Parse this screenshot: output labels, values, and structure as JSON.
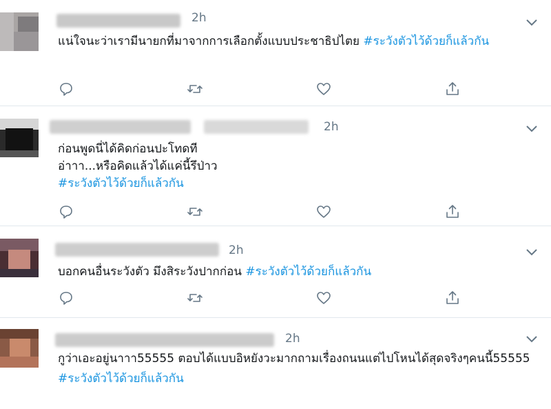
{
  "tweets": [
    {
      "time": "2h",
      "text": "แน่ใจนะว่าเรามีนายกที่มาจากการเลือกตั้งแบบประชาธิปไตย",
      "hashtag": "#ระวังตัวไว้ด้วยก็แล้วกัน"
    },
    {
      "time": "2h",
      "text": "ก่อนพูดนี่ได้คิดก่อนปะโทดที\nอ่าาา...หรือคิดแล้วได้แค่นี้รึป่าว",
      "hashtag": "#ระวังตัวไว้ด้วยก็แล้วกัน"
    },
    {
      "time": "2h",
      "text": "บอกคนอื่นระวังตัว มึงสิระวังปากก่อน",
      "hashtag": "#ระวังตัวไว้ด้วยก็แล้วกัน"
    },
    {
      "time": "2h",
      "text": "กูว่าเอะอยู่นาาา55555 ตอบได้แบบอิหยังวะมากถามเรื่องถนนแต่ไปโหนได้สุดจริงๆคนนี้55555",
      "hashtag": "#ระวังตัวไว้ด้วยก็แล้วกัน"
    }
  ],
  "icons": {
    "reply": "reply-icon",
    "retweet": "retweet-icon",
    "like": "heart-icon",
    "share": "share-icon",
    "menu": "chevron-down-icon"
  },
  "colors": {
    "hashtag": "#1b95e0",
    "muted": "#657786",
    "divider": "#e1e8ed"
  }
}
